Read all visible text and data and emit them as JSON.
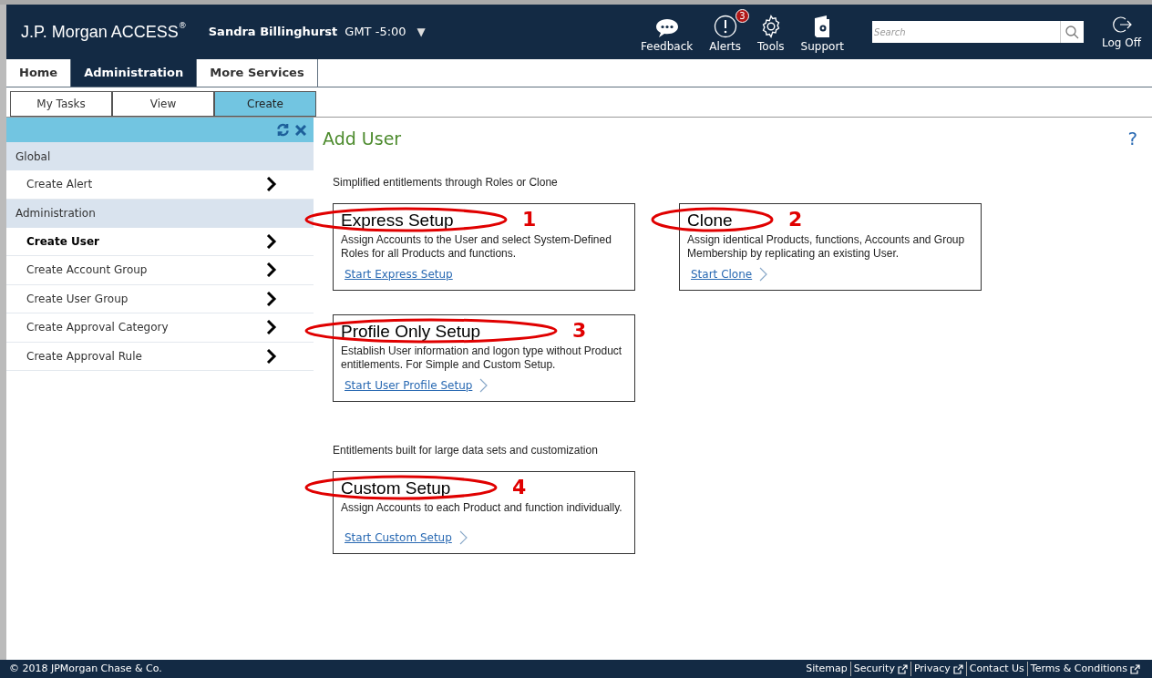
{
  "header": {
    "logo": "J.P. Morgan ACCESS",
    "logo_mark": "®",
    "user": "Sandra Billinghurst",
    "timezone": "GMT -5:00",
    "dropdown": "▼",
    "actions": [
      {
        "kind": "feedback",
        "label": "Feedback"
      },
      {
        "kind": "alerts",
        "label": "Alerts",
        "badge": "3"
      },
      {
        "kind": "tools",
        "label": "Tools"
      },
      {
        "kind": "support",
        "label": "Support"
      }
    ],
    "search": {
      "placeholder": "Search"
    },
    "logoff": "Log Off"
  },
  "nav_tabs": [
    {
      "label": "Home",
      "selected": false
    },
    {
      "label": "Administration",
      "selected": true
    },
    {
      "label": "More Services",
      "selected": false
    }
  ],
  "sub_tabs": [
    {
      "label": "My Tasks",
      "selected": false
    },
    {
      "label": "View",
      "selected": false
    },
    {
      "label": "Create",
      "selected": true
    }
  ],
  "sidebar": {
    "sections": [
      {
        "title": "Global",
        "items": [
          {
            "label": "Create Alert",
            "selected": false
          }
        ]
      },
      {
        "title": "Administration",
        "items": [
          {
            "label": "Create User",
            "selected": true
          },
          {
            "label": "Create Account Group",
            "selected": false
          },
          {
            "label": "Create User Group",
            "selected": false
          },
          {
            "label": "Create Approval Category",
            "selected": false
          },
          {
            "label": "Create Approval Rule",
            "selected": false
          }
        ]
      }
    ]
  },
  "page": {
    "title": "Add User",
    "help": "?",
    "groups": [
      {
        "caption": "Simplified entitlements through Roles or Clone",
        "cards": [
          {
            "title": "Express Setup",
            "number": "1",
            "description": "Assign Accounts to the User and select System-Defined Roles for all Products and functions.",
            "link": "Start Express Setup",
            "chevron": false
          },
          {
            "title": "Clone",
            "number": "2",
            "description": "Assign identical Products, functions, Accounts and Group Membership by replicating an existing User.",
            "link": "Start Clone",
            "chevron": true
          },
          {
            "title": "Profile Only Setup",
            "number": "3",
            "description": "Establish User information and logon type without Product entitlements. For Simple and Custom Setup.",
            "link": "Start User Profile Setup",
            "chevron": true
          }
        ]
      },
      {
        "caption": "Entitlements built for large data sets and customization",
        "cards": [
          {
            "title": "Custom Setup",
            "number": "4",
            "description": "Assign Accounts to each Product and function individually.",
            "link": "Start Custom Setup",
            "chevron": true
          }
        ]
      }
    ]
  },
  "footer": {
    "copyright": "© 2018 JPMorgan Chase & Co.",
    "links": [
      {
        "label": "Sitemap",
        "external": false
      },
      {
        "label": "Security",
        "external": true
      },
      {
        "label": "Privacy",
        "external": true
      },
      {
        "label": "Contact Us",
        "external": false
      },
      {
        "label": "Terms & Conditions",
        "external": true
      }
    ]
  }
}
